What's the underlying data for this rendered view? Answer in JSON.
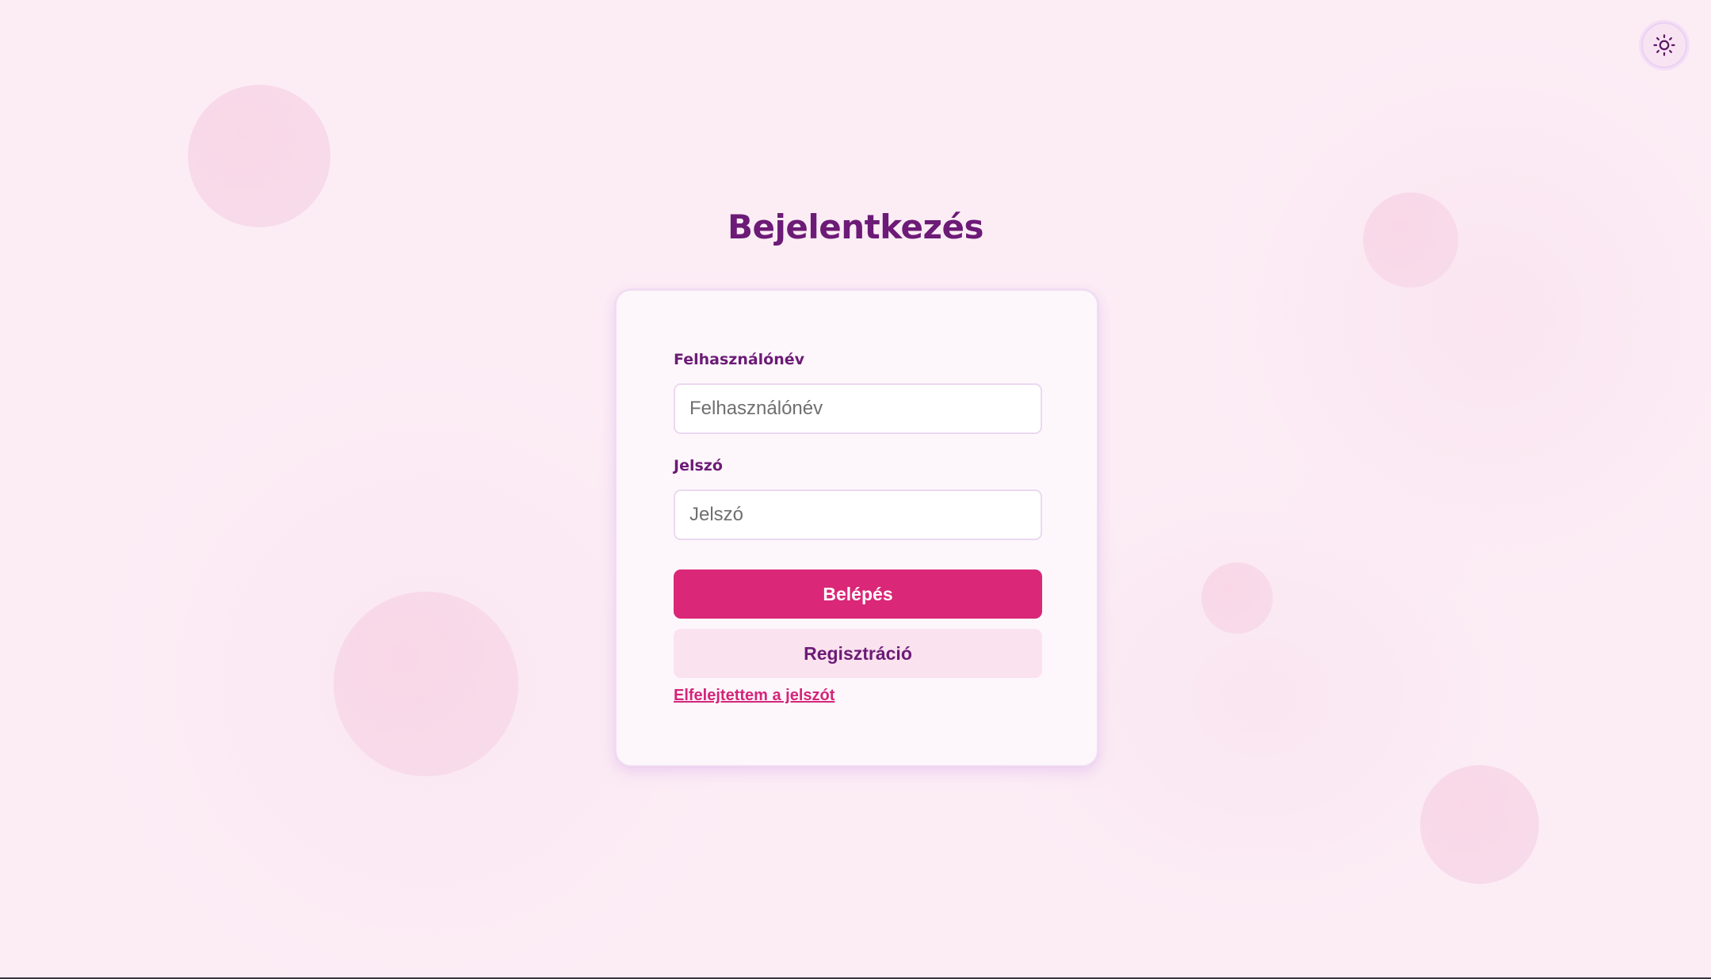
{
  "page": {
    "title": "Bejelentkezés"
  },
  "theme_toggle": {
    "icon": "sun-icon"
  },
  "login_form": {
    "username_label": "Felhasználónév",
    "username_placeholder": "Felhasználónév",
    "username_value": "",
    "password_label": "Jelszó",
    "password_placeholder": "Jelszó",
    "password_value": "",
    "login_button": "Belépés",
    "register_button": "Regisztráció",
    "forgot_password_link": "Elfelejtettem a jelszót"
  },
  "colors": {
    "background": "#fcedf5",
    "primary": "#da2777",
    "accent_text": "#6c1b76",
    "secondary_button": "#fbe2ef",
    "link": "#d4257a"
  }
}
